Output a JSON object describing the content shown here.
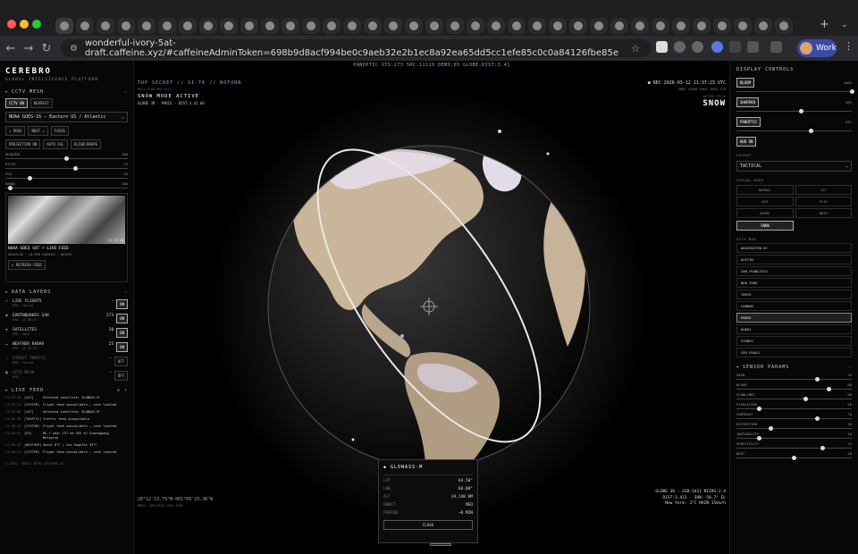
{
  "browser": {
    "url": "wonderful-ivory-5at-draft.caffeine.xyz/#caffeineAdminToken=698b9d8acf994be0c9aeb32e2b1ec8a92ea65dd5cc1efe85c0c0a84126fbe85e",
    "profile": "Work"
  },
  "left": {
    "brand": "CEREBRO",
    "subtitle": "GLOBAL INTELLIGENCE PLATFORM",
    "cctv": {
      "title": "CCTV MESH",
      "btn_on": "CCTV ON",
      "btn_nearest": "NEAREST",
      "feed_select": "NOAA GOES-16 — Eastern US / Atlantic",
      "prev": "◂ PREV",
      "next": "NEXT ▸",
      "focus": "FOCUS",
      "proj": "PROJECTION ON",
      "autocal": "AUTO CAL",
      "align": "ALIGN-DRAPE",
      "sliders": [
        {
          "label": "HEADING",
          "value": "180",
          "frac": 0.5
        },
        {
          "label": "PITCH",
          "value": "15",
          "frac": 0.57
        },
        {
          "label": "FOV",
          "value": "45",
          "frac": 0.2
        },
        {
          "label": "RANGE",
          "value": "200",
          "frac": 0.04
        }
      ],
      "cam_title": "NOAA GOES SAT • LIVE FEED",
      "cam_sub": "GEOCOLOR · 10-MIN CADENCE · NESDIS",
      "cam_ts": "21:37:20",
      "refresh": "↻ REFRESH FEED"
    },
    "layers": {
      "title": "DATA LAYERS",
      "items": [
        {
          "icon": "✈",
          "name": "LIVE FLIGHTS",
          "sub": "UPD: failed",
          "count": "—",
          "state": "ON",
          "dim": false
        },
        {
          "icon": "◉",
          "name": "EARTHQUAKES 24H",
          "sub": "UPD: 21:36:53",
          "count": "273",
          "state": "ON",
          "dim": false
        },
        {
          "icon": "◈",
          "name": "SATELLITES",
          "sub": "UPD: 40ch",
          "count": "20",
          "state": "ON",
          "dim": false
        },
        {
          "icon": "☁",
          "name": "WEATHER RADAR",
          "sub": "UPD: 21:35:21",
          "count": "25",
          "state": "ON",
          "dim": false
        },
        {
          "icon": "◌",
          "name": "STREET TRAFFIC",
          "sub": "UPD: failed",
          "count": "—",
          "state": "OFF",
          "dim": true
        },
        {
          "icon": "▣",
          "name": "CCTV MESH",
          "sub": "UPD: —",
          "count": "—",
          "state": "OFF",
          "dim": true
        }
      ]
    },
    "feed": {
      "title": "LIVE FEED",
      "items": [
        {
          "time": "21:37:13",
          "cat": "[SAT]",
          "msg": "Selected satellite: GLONASS-M"
        },
        {
          "time": "21:37:11",
          "cat": "[SYSTEM]",
          "msg": "Flight feed unavailable — rate limited"
        },
        {
          "time": "21:37:09",
          "cat": "[SAT]",
          "msg": "Selected satellite: GLONASS-M"
        },
        {
          "time": "21:36:53",
          "cat": "[TRAFFIC]",
          "msg": "Traffic feed unavailable"
        },
        {
          "time": "21:36:53",
          "cat": "[SYSTEM]",
          "msg": "Flight feed unavailable — rate limited"
        },
        {
          "time": "21:36:41",
          "cat": "[EQ]",
          "msg": "M4.7 near 157 km SSE of Simanggang, Malaysia"
        },
        {
          "time": "21:36:32",
          "cat": "[WEATHER]",
          "msg": "Seoul 0°C | Los Angeles 33°C"
        },
        {
          "time": "21:36:21",
          "cat": "[SYSTEM]",
          "msg": "Flight feed unavailable — rate limited"
        }
      ]
    },
    "footer": "© 2026 · BUILT WITH CAFFEINE.AI"
  },
  "center": {
    "topstat": "PANOPTIC VIS:273 SRC:11110 DENS:65 GLOBE-DIST:3.41",
    "class": "TOP SECRET // SI-TK // NOFORN",
    "class_sub": "KH11-4166 OPS-4117",
    "mode": "SNOW MODE ACTIVE",
    "mode_sub": "GLOBE 3D · PARIS · DIST:3.41 AU",
    "rec": "● REC 2026-03-12 21:37:23 UTC",
    "rec_sub": "ORB: 47439 PASS: DESC-178",
    "style_label": "ACTIVE STYLE",
    "style_value": "SNOW",
    "coords": "26°12'13.79\"N 061°09'23.36\"W",
    "coords_sub": "MGRS: 20R 6538 1565 2030",
    "bottom_right": [
      "GLOBE 3D · GSD:3411 NIIRS:2.4",
      "DIST:3.411 · SUN:-50.7° EL",
      "New York: 3°C RAIN 15km/h"
    ],
    "sat": {
      "name": "◆ GLONASS-M",
      "rows": [
        {
          "k": "LAT",
          "v": "64.50°"
        },
        {
          "k": "LNG",
          "v": "60.00°"
        },
        {
          "k": "ALT",
          "v": "19,148 KM"
        },
        {
          "k": "ORBIT",
          "v": "MEO"
        },
        {
          "k": "PERIOD",
          "v": "~0 MIN"
        }
      ],
      "close": "CLOSE"
    }
  },
  "right": {
    "title": "DISPLAY CONTROLS",
    "toggles": [
      {
        "label": "BLOOM",
        "pct": "100%",
        "frac": 1.0
      },
      {
        "label": "SHARPEN",
        "pct": "56%",
        "frac": 0.56
      },
      {
        "label": "PANOPTIC",
        "pct": "65%",
        "frac": 0.65
      }
    ],
    "hud": "HUD ON",
    "layout_label": "LAYOUT",
    "layout_value": "TACTICAL",
    "visual_label": "VISUAL MODE",
    "visual_modes": [
      "NORMAL",
      "CRT",
      "NVG",
      "FLIR",
      "ANIME",
      "NOIR"
    ],
    "snow": "SNOW",
    "city_label": "CITY NAV",
    "cities": [
      "WASHINGTON DC",
      "AUSTIN",
      "SAN FRANCISCO",
      "NEW YORK",
      "TOKYO",
      "LONDON",
      "PARIS",
      "DUBAI",
      "SYDNEY",
      "SÃO PAULO"
    ],
    "active_city": "PARIS",
    "sensor_title": "SENSOR PARAMS",
    "sensors": [
      {
        "label": "GAIN",
        "value": "70",
        "frac": 0.7
      },
      {
        "label": "BLOOM",
        "value": "80",
        "frac": 0.8
      },
      {
        "label": "SCANLINES",
        "value": "60",
        "frac": 0.6
      },
      {
        "label": "PIXELATION",
        "value": "20",
        "frac": 0.2
      },
      {
        "label": "CONTRAST",
        "value": "70",
        "frac": 0.7
      },
      {
        "label": "DISTORTION",
        "value": "30",
        "frac": 0.3
      },
      {
        "label": "INSTABILITY",
        "value": "20",
        "frac": 0.2
      },
      {
        "label": "SENSITIVITY",
        "value": "75",
        "frac": 0.75
      },
      {
        "label": "WHOT",
        "value": "50",
        "frac": 0.5
      }
    ]
  }
}
